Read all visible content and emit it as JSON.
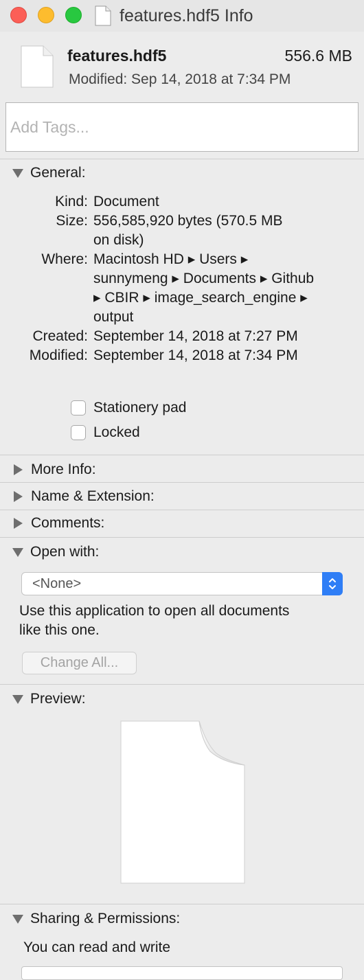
{
  "window": {
    "title": "features.hdf5 Info"
  },
  "header": {
    "file_name": "features.hdf5",
    "file_size": "556.6 MB",
    "modified": "Modified: Sep 14, 2018 at 7:34 PM"
  },
  "tags": {
    "placeholder": "Add Tags..."
  },
  "general": {
    "label": "General:",
    "kind_label": "Kind:",
    "kind_value": "Document",
    "size_label": "Size:",
    "size_value_line1": "556,585,920 bytes (570.5 MB",
    "size_value_line2": "on disk)",
    "where_label": "Where:",
    "where_line1": "Macintosh HD ▸ Users ▸",
    "where_line2": "sunnymeng ▸ Documents ▸ Github",
    "where_line3": "▸ CBIR ▸ image_search_engine ▸",
    "where_line4": "output",
    "created_label": "Created:",
    "created_value": "September 14, 2018 at 7:27 PM",
    "modified_label": "Modified:",
    "modified_value": "September 14, 2018 at 7:34 PM",
    "stationery_label": "Stationery pad",
    "stationery_checked": false,
    "locked_label": "Locked",
    "locked_checked": false
  },
  "sections": {
    "more_info": "More Info:",
    "name_extension": "Name & Extension:",
    "comments": "Comments:",
    "open_with": "Open with:",
    "preview": "Preview:",
    "sharing": "Sharing & Permissions:"
  },
  "open_with": {
    "selected_app": "<None>",
    "help_line1": "Use this application to open all documents",
    "help_line2": "like this one.",
    "change_all_label": "Change All..."
  },
  "permissions": {
    "status": "You can read and write"
  },
  "colors": {
    "close": "#fc5f57",
    "minimize": "#fdbc2e",
    "zoom": "#28c840",
    "popup_accent": "#2f7ef6",
    "window_bg": "#ececec"
  }
}
